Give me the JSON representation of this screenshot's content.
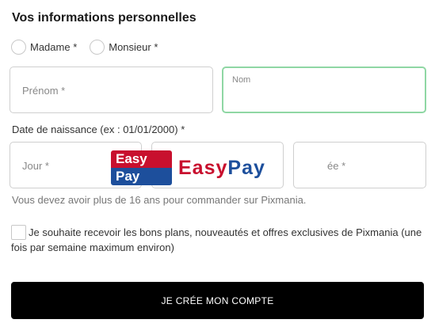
{
  "title": "Vos informations personnelles",
  "civility": {
    "options": [
      "Madame *",
      "Monsieur *"
    ]
  },
  "fields": {
    "prenom_placeholder": "Prénom *",
    "nom_label": "Nom",
    "dob_label": "Date de naissance (ex : 01/01/2000) *",
    "jour_placeholder": "Jour *",
    "annee_placeholder_partial": "ée *"
  },
  "age_note": "Vous devez avoir plus de 16 ans pour commander sur Pixmania.",
  "newsletter": {
    "text": "Je souhaite recevoir les bons plans, nouveautés et offres exclusives de Pixmania (une fois par semaine maximum environ)"
  },
  "submit_label": "JE CRÉE MON COMPTE",
  "overlay": {
    "logo_top": "Easy",
    "logo_bottom": "Pay",
    "word_easy": "Easy",
    "word_pay": "Pay",
    "colors": {
      "red": "#c8102e",
      "blue": "#1d4f9c"
    }
  },
  "colors": {
    "focus_border": "#8fd7a4",
    "button_bg": "#000000"
  }
}
